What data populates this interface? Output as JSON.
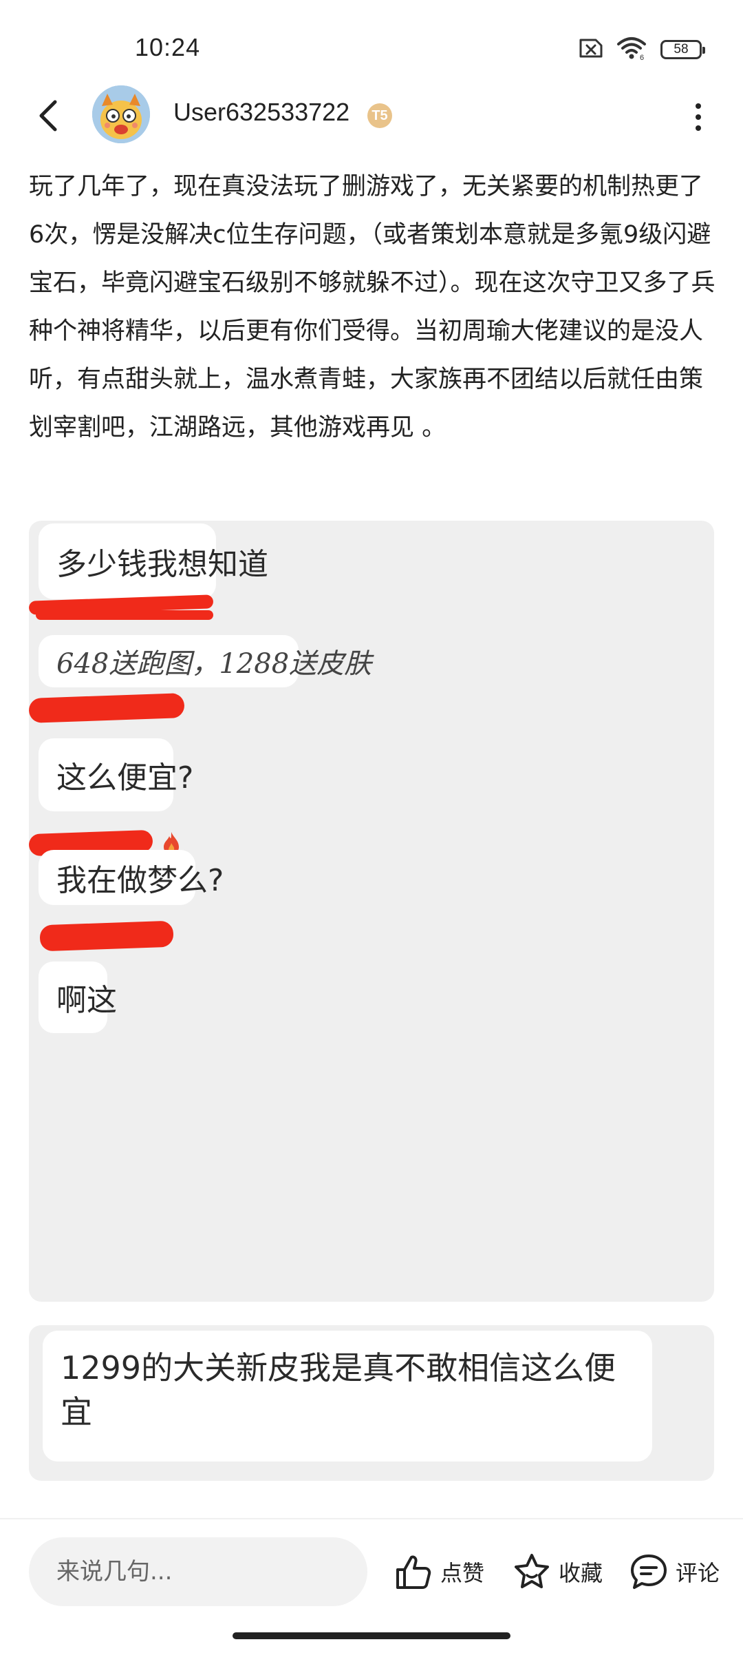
{
  "status_bar": {
    "time": "10:24",
    "battery": "58",
    "icons": [
      "sim-off-icon",
      "wifi-6-icon",
      "battery-icon"
    ]
  },
  "header": {
    "username": "User632533722",
    "level_badge": "T5",
    "icons": [
      "back-arrow-icon",
      "avatar",
      "more-vertical-icon"
    ]
  },
  "post": {
    "text": "玩了几年了，现在真没法玩了删游戏了，无关紧要的机制热更了6次，愣是没解决c位生存问题，（或者策划本意就是多氪9级闪避宝石，毕竟闪避宝石级别不够就躲不过）。现在这次守卫又多了兵种个神将精华，以后更有你们受得。当初周瑜大佬建议的是没人听，有点甜头就上，温水煮青蛙，大家族再不团结以后就任由策划宰割吧，江湖路远，其他游戏再见 。"
  },
  "screenshot_1": {
    "messages": [
      "多少钱我想知道",
      "648送跑图，1288送皮肤",
      "这么便宜?",
      "我在做梦么?",
      "啊这"
    ]
  },
  "screenshot_2": {
    "message": "1299的大关新皮我是真不敢相信这么便宜"
  },
  "bottom_bar": {
    "comment_placeholder": "来说几句...",
    "like_label": "点赞",
    "favorite_label": "收藏",
    "comment_label": "评论"
  },
  "colors": {
    "redaction": "#f02a1a",
    "panel_background": "#efefef",
    "text": "#222222"
  }
}
